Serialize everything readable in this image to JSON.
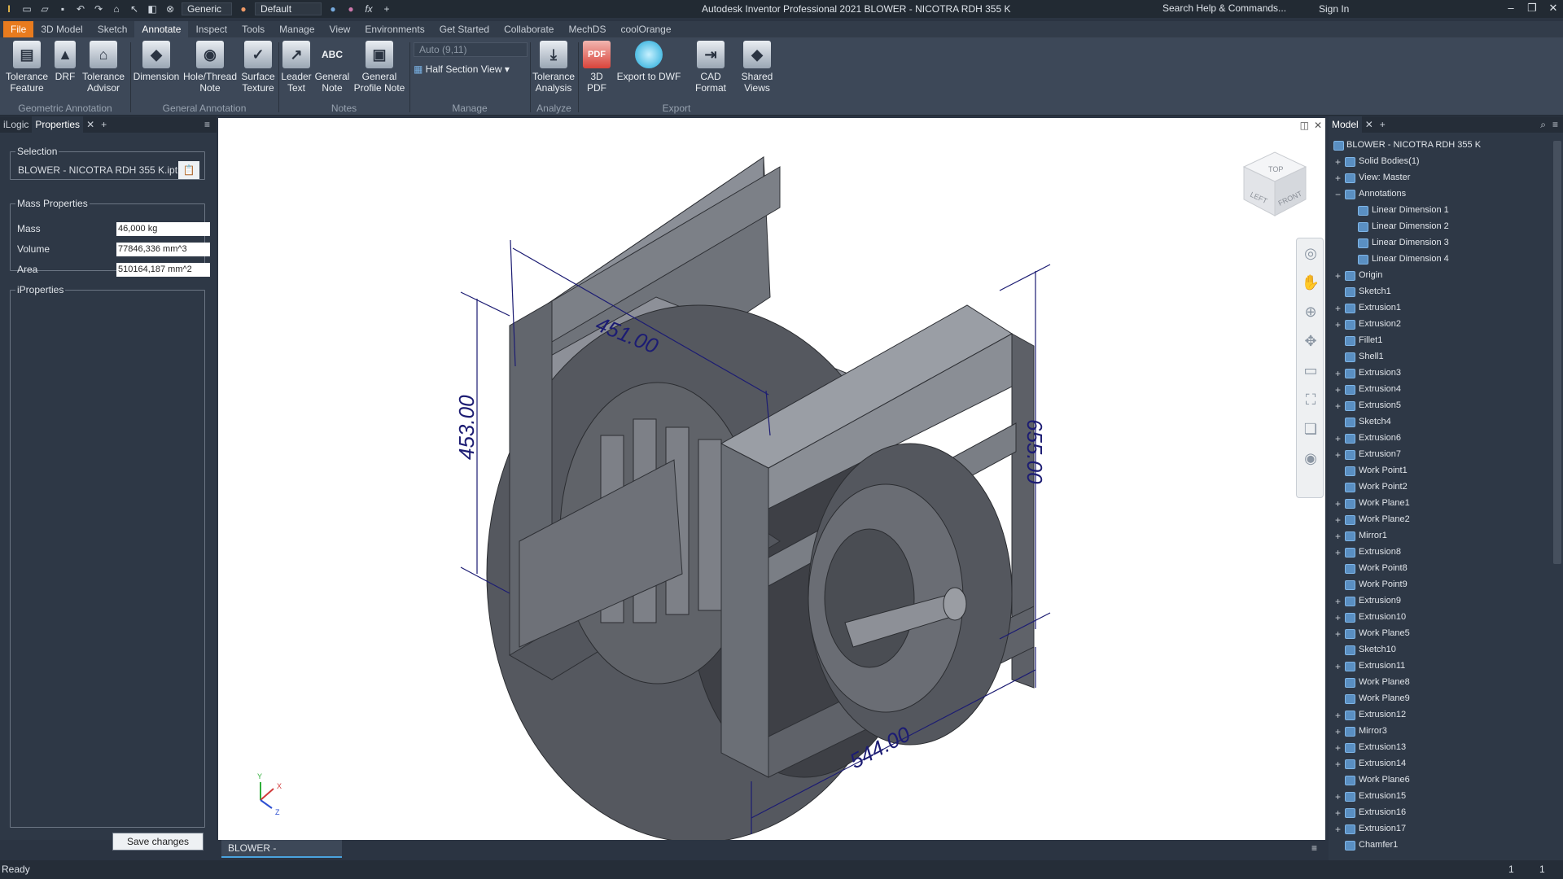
{
  "app": {
    "title": "Autodesk Inventor Professional 2021   BLOWER - NICOTRA RDH 355 K",
    "search": "Search Help & Commands...",
    "sign_in": "Sign In",
    "appearance_select": "Generic",
    "material_select": "Default",
    "formula_icon": "fx"
  },
  "ribbon_tabs": [
    "File",
    "3D Model",
    "Sketch",
    "Annotate",
    "Inspect",
    "Tools",
    "Manage",
    "View",
    "Environments",
    "Get Started",
    "Collaborate",
    "MechDS",
    "coolOrange"
  ],
  "ribbon": {
    "tolerance_feature": "Tolerance\nFeature",
    "drf": "DRF",
    "tolerance_advisor": "Tolerance\nAdvisor",
    "dimension": "Dimension",
    "hole_thread_note": "Hole/Thread\nNote",
    "surface_texture": "Surface\nTexture",
    "leader_text": "Leader\nText",
    "general_note": "General\nNote",
    "general_note_glyph": "ABC",
    "general_profile_note": "General\nProfile Note",
    "auto_select": "Auto (9,11)",
    "half_section_view": "Half Section View",
    "tolerance_analysis": "Tolerance\nAnalysis",
    "pdf_3d": "3D PDF",
    "export_dwf": "Export to DWF",
    "cad_format": "CAD Format",
    "shared_views": "Shared\nViews",
    "groups": {
      "geometric": "Geometric Annotation",
      "general": "General Annotation",
      "notes": "Notes",
      "manage": "Manage",
      "analyze": "Analyze",
      "export": "Export"
    }
  },
  "left_panel": {
    "tab_ilogic": "iLogic",
    "tab_properties": "Properties",
    "selection_legend": "Selection",
    "selection_value": "BLOWER - NICOTRA RDH 355 K.ipt",
    "mass_legend": "Mass Properties",
    "mass_label": "Mass",
    "mass_value": "46,000 kg",
    "volume_label": "Volume",
    "volume_value": "77846,336 mm^3",
    "area_label": "Area",
    "area_value": "510164,187 mm^2",
    "iprops_legend": "iProperties",
    "save_changes": "Save changes"
  },
  "viewport": {
    "dims": {
      "d451": "451.00",
      "d453": "453.00",
      "d655": "655.00",
      "d544": "544.00"
    },
    "viewcube": {
      "top": "TOP",
      "left": "LEFT",
      "front": "FRONT"
    },
    "triad": {
      "x": "X",
      "y": "Y",
      "z": "Z"
    }
  },
  "doc_tab": "BLOWER - NICOT...ipt",
  "status": {
    "ready": "Ready",
    "count1": "1",
    "count2": "1"
  },
  "model_panel": {
    "tab": "Model",
    "root": "BLOWER - NICOTRA RDH 355 K",
    "items": [
      {
        "label": "Solid Bodies(1)",
        "expand": "+",
        "indent": 0
      },
      {
        "label": "View: Master",
        "expand": "+",
        "indent": 0
      },
      {
        "label": "Annotations",
        "expand": "−",
        "indent": 0
      },
      {
        "label": "Linear Dimension 1",
        "expand": "",
        "indent": 1
      },
      {
        "label": "Linear Dimension 2",
        "expand": "",
        "indent": 1
      },
      {
        "label": "Linear Dimension 3",
        "expand": "",
        "indent": 1
      },
      {
        "label": "Linear Dimension 4",
        "expand": "",
        "indent": 1
      },
      {
        "label": "Origin",
        "expand": "+",
        "indent": 0
      },
      {
        "label": "Sketch1",
        "expand": "",
        "indent": 0
      },
      {
        "label": "Extrusion1",
        "expand": "+",
        "indent": 0
      },
      {
        "label": "Extrusion2",
        "expand": "+",
        "indent": 0
      },
      {
        "label": "Fillet1",
        "expand": "",
        "indent": 0
      },
      {
        "label": "Shell1",
        "expand": "",
        "indent": 0
      },
      {
        "label": "Extrusion3",
        "expand": "+",
        "indent": 0
      },
      {
        "label": "Extrusion4",
        "expand": "+",
        "indent": 0
      },
      {
        "label": "Extrusion5",
        "expand": "+",
        "indent": 0
      },
      {
        "label": "Sketch4",
        "expand": "",
        "indent": 0
      },
      {
        "label": "Extrusion6",
        "expand": "+",
        "indent": 0
      },
      {
        "label": "Extrusion7",
        "expand": "+",
        "indent": 0
      },
      {
        "label": "Work Point1",
        "expand": "",
        "indent": 0
      },
      {
        "label": "Work Point2",
        "expand": "",
        "indent": 0
      },
      {
        "label": "Work Plane1",
        "expand": "+",
        "indent": 0
      },
      {
        "label": "Work Plane2",
        "expand": "+",
        "indent": 0
      },
      {
        "label": "Mirror1",
        "expand": "+",
        "indent": 0
      },
      {
        "label": "Extrusion8",
        "expand": "+",
        "indent": 0
      },
      {
        "label": "Work Point8",
        "expand": "",
        "indent": 0
      },
      {
        "label": "Work Point9",
        "expand": "",
        "indent": 0
      },
      {
        "label": "Extrusion9",
        "expand": "+",
        "indent": 0
      },
      {
        "label": "Extrusion10",
        "expand": "+",
        "indent": 0
      },
      {
        "label": "Work Plane5",
        "expand": "+",
        "indent": 0
      },
      {
        "label": "Sketch10",
        "expand": "",
        "indent": 0
      },
      {
        "label": "Extrusion11",
        "expand": "+",
        "indent": 0
      },
      {
        "label": "Work Plane8",
        "expand": "",
        "indent": 0
      },
      {
        "label": "Work Plane9",
        "expand": "",
        "indent": 0
      },
      {
        "label": "Extrusion12",
        "expand": "+",
        "indent": 0
      },
      {
        "label": "Mirror3",
        "expand": "+",
        "indent": 0
      },
      {
        "label": "Extrusion13",
        "expand": "+",
        "indent": 0
      },
      {
        "label": "Extrusion14",
        "expand": "+",
        "indent": 0
      },
      {
        "label": "Work Plane6",
        "expand": "",
        "indent": 0
      },
      {
        "label": "Extrusion15",
        "expand": "+",
        "indent": 0
      },
      {
        "label": "Extrusion16",
        "expand": "+",
        "indent": 0
      },
      {
        "label": "Extrusion17",
        "expand": "+",
        "indent": 0
      },
      {
        "label": "Chamfer1",
        "expand": "",
        "indent": 0
      }
    ]
  }
}
